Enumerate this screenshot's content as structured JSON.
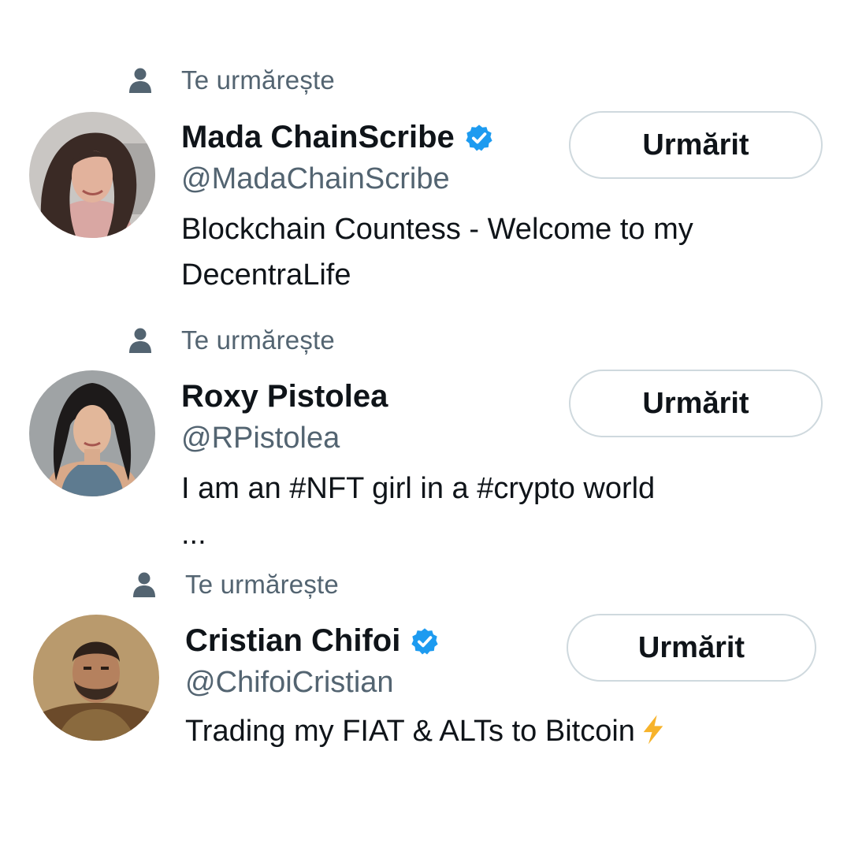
{
  "entries": [
    {
      "follows_label": "Te urmărește",
      "name": "Mada ChainScribe",
      "verified": true,
      "handle": "@MadaChainScribe",
      "bio_lines": [
        "Blockchain Countess - Welcome to my",
        "DecentraLife"
      ],
      "button_label": "Urmărit"
    },
    {
      "follows_label": "Te urmărește",
      "name": "Roxy Pistolea",
      "verified": false,
      "handle": "@RPistolea",
      "bio_lines": [
        "I am an #NFT girl in a #crypto world",
        "..."
      ],
      "button_label": "Urmărit"
    },
    {
      "follows_label": "Te urmărește",
      "name": "Cristian Chifoi",
      "verified": true,
      "handle": "@ChifoiCristian",
      "bio_lines": [
        "Trading my FIAT & ALTs to Bitcoin"
      ],
      "bio_emoji": "lightning-bolt-icon",
      "button_label": "Urmărit"
    }
  ],
  "colors": {
    "primary_text": "#0f1419",
    "secondary_text": "#536471",
    "verified_blue": "#1d9bf0",
    "button_border": "#cfd9de"
  }
}
